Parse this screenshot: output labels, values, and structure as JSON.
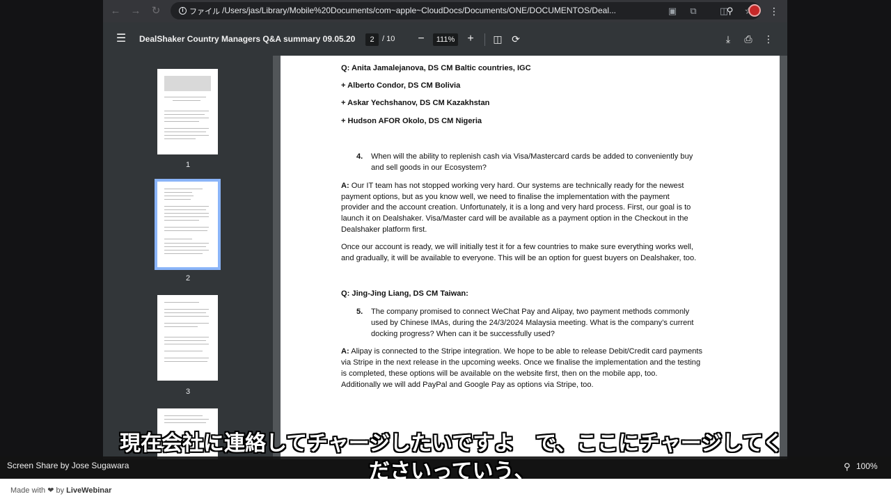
{
  "browser": {
    "security_label": "ファイル",
    "url": "/Users/jas/Library/Mobile%20Documents/com~apple~CloudDocs/Documents/ONE/DOCUMENTOS/Deal..."
  },
  "pdf_toolbar": {
    "title": "DealShaker Country Managers Q&A summary 09.05.20...",
    "current_page": "2",
    "page_total": "/ 10",
    "zoom": "111%"
  },
  "thumbnails": [
    {
      "number": "1",
      "active": false
    },
    {
      "number": "2",
      "active": true
    },
    {
      "number": "3",
      "active": false
    }
  ],
  "document": {
    "q_header": "Q: Anita Jamalejanova, DS CM Baltic countries, IGC",
    "plus_lines": [
      "+ Alberto Condor, DS CM Bolivia",
      "+ Askar Yechshanov, DS CM Kazakhstan",
      "+ Hudson AFOR Okolo, DS CM Nigeria"
    ],
    "q4_number": "4.",
    "q4_lines": [
      "When will the ability to replenish cash via Visa/Mastercard cards be added to conveniently buy",
      "and sell goods in our Ecosystem?"
    ],
    "a4_prefix": "A:",
    "a4_lines": [
      " Our IT team has not stopped working very hard. Our systems are technically ready for the newest",
      "payment options, but as you know well, we need to finalise the implementation with the payment",
      "provider and the account creation. Unfortunately, it is a long and very hard process. First, our goal is to",
      "launch it on Dealshaker. Visa/Master card will be available as a payment option in the Checkout in the",
      "Dealshaker platform first."
    ],
    "a4b_lines": [
      "Once our account is ready, we will initially test it for a few countries to make sure everything works well,",
      "and gradually, it will be available to everyone. This will be an option for guest buyers on Dealshaker, too."
    ],
    "q5_header": "Q: Jing-Jing Liang, DS CM Taiwan:",
    "q5_number": "5.",
    "q5_lines": [
      "The company promised to connect WeChat Pay and Alipay, two payment methods commonly",
      "used by Chinese IMAs, during the 24/3/2024 Malaysia meeting. What is the company’s current",
      "docking progress? When can it be successfully used?"
    ],
    "a5_prefix": "A:",
    "a5_lines": [
      " Alipay is connected to the Stripe integration. We hope to be able to release Debit/Credit card payments",
      "via Stripe in the next release in the upcoming weeks. Once we finalise the implementation and the testing",
      "is completed, these options will be available on the website first, then on the mobile app, too.",
      "Additionally we will add PayPal and Google Pay as options via Stripe, too."
    ]
  },
  "subtitles": {
    "line1": "現在会社に連絡してチャージしたいですよ　で、ここにチャージしてく",
    "line2": "ださいっていう、"
  },
  "webinar": {
    "share_label": "Screen Share by Jose Sugawara",
    "zoom": "100%"
  },
  "footer": {
    "made_with": "Made with",
    "by": "by",
    "brand": "LiveWebinar"
  }
}
